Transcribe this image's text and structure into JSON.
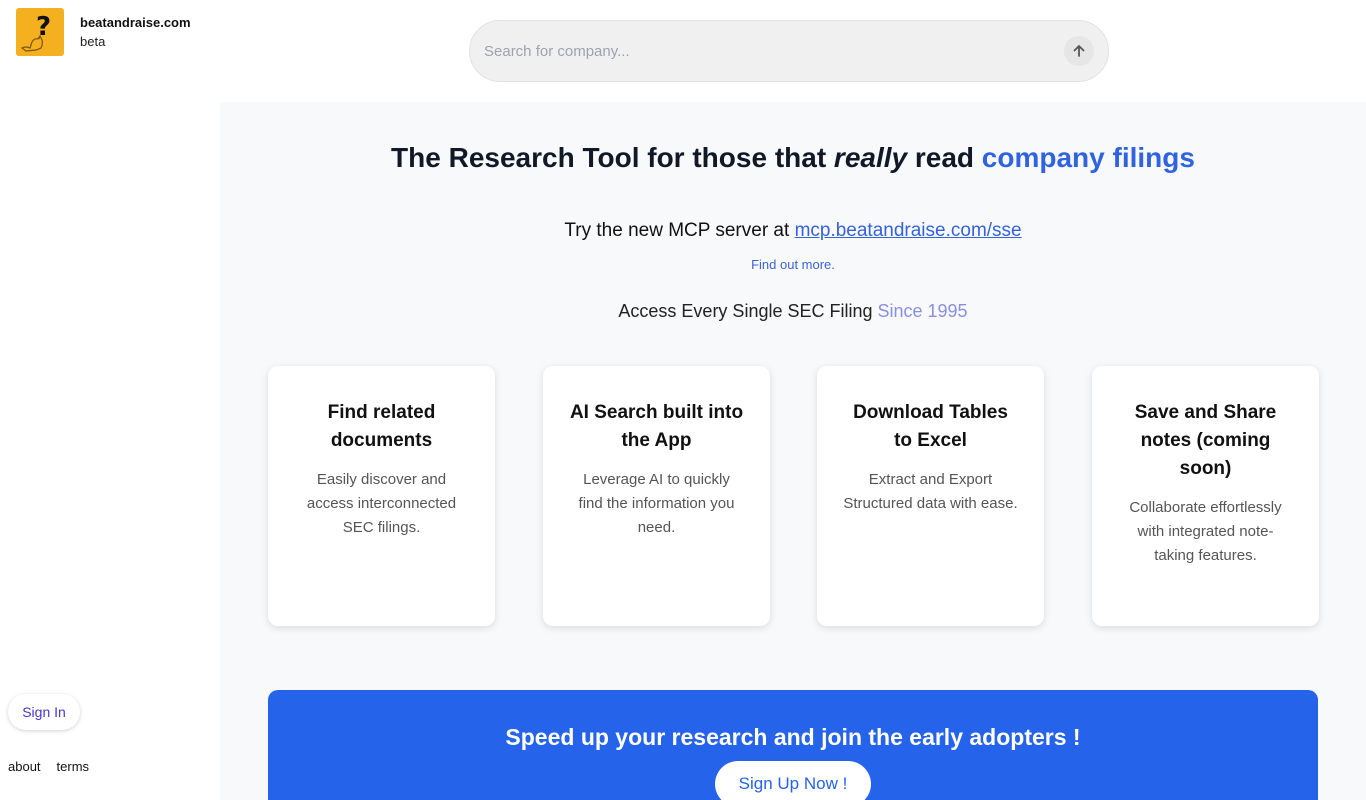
{
  "brand": {
    "name": "beatandraise.com",
    "tag": "beta"
  },
  "search": {
    "placeholder": "Search for company..."
  },
  "sidebar": {
    "signin_label": "Sign In",
    "links": [
      "about",
      "terms"
    ]
  },
  "hero": {
    "title_part1": "The Research Tool for those that ",
    "title_emph": "really",
    "title_part2": " read ",
    "title_accent": "company filings",
    "mcp_prefix": "Try the new MCP server at ",
    "mcp_link": "mcp.beatandraise.com/sse",
    "find_more": "Find out more.",
    "access_prefix": "Access Every Single SEC Filing ",
    "access_since": "Since 1995"
  },
  "features": [
    {
      "title": "Find related documents",
      "desc": "Easily discover and access interconnected SEC filings."
    },
    {
      "title": "AI Search built into the App",
      "desc": "Leverage AI to quickly find the information you need."
    },
    {
      "title": "Download Tables to Excel",
      "desc": "Extract and Export Structured data with ease."
    },
    {
      "title": "Save and Share notes (coming soon)",
      "desc": "Collaborate effortlessly with integrated note-taking features."
    }
  ],
  "cta": {
    "title": "Speed up your research and join the early adopters !",
    "button": "Sign Up Now !"
  },
  "colors": {
    "accent": "#2563eb",
    "logo_bg": "#f4b01e",
    "since": "#8b8fe0"
  },
  "icons": {
    "logo": "dog-question-mark-logo",
    "search_submit": "arrow-up-icon"
  }
}
